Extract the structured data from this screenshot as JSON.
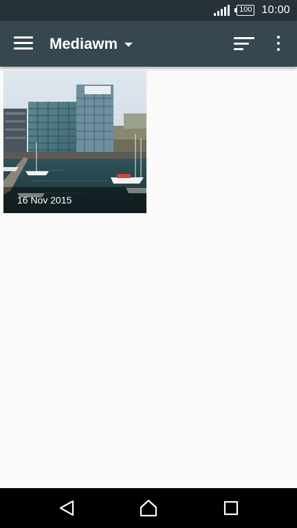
{
  "status_bar": {
    "battery_level": "100",
    "time": "10:00"
  },
  "app_bar": {
    "title": "Mediawm",
    "icons": {
      "menu": "hamburger-menu-icon",
      "dropdown": "caret-down-icon",
      "sort": "sort-icon",
      "overflow": "more-vert-icon"
    }
  },
  "albums": [
    {
      "date_label": "16 Nov 2015"
    }
  ],
  "nav_bar": {
    "icons": {
      "back": "back-triangle-icon",
      "home": "home-icon",
      "recent": "recent-apps-square-icon"
    }
  }
}
